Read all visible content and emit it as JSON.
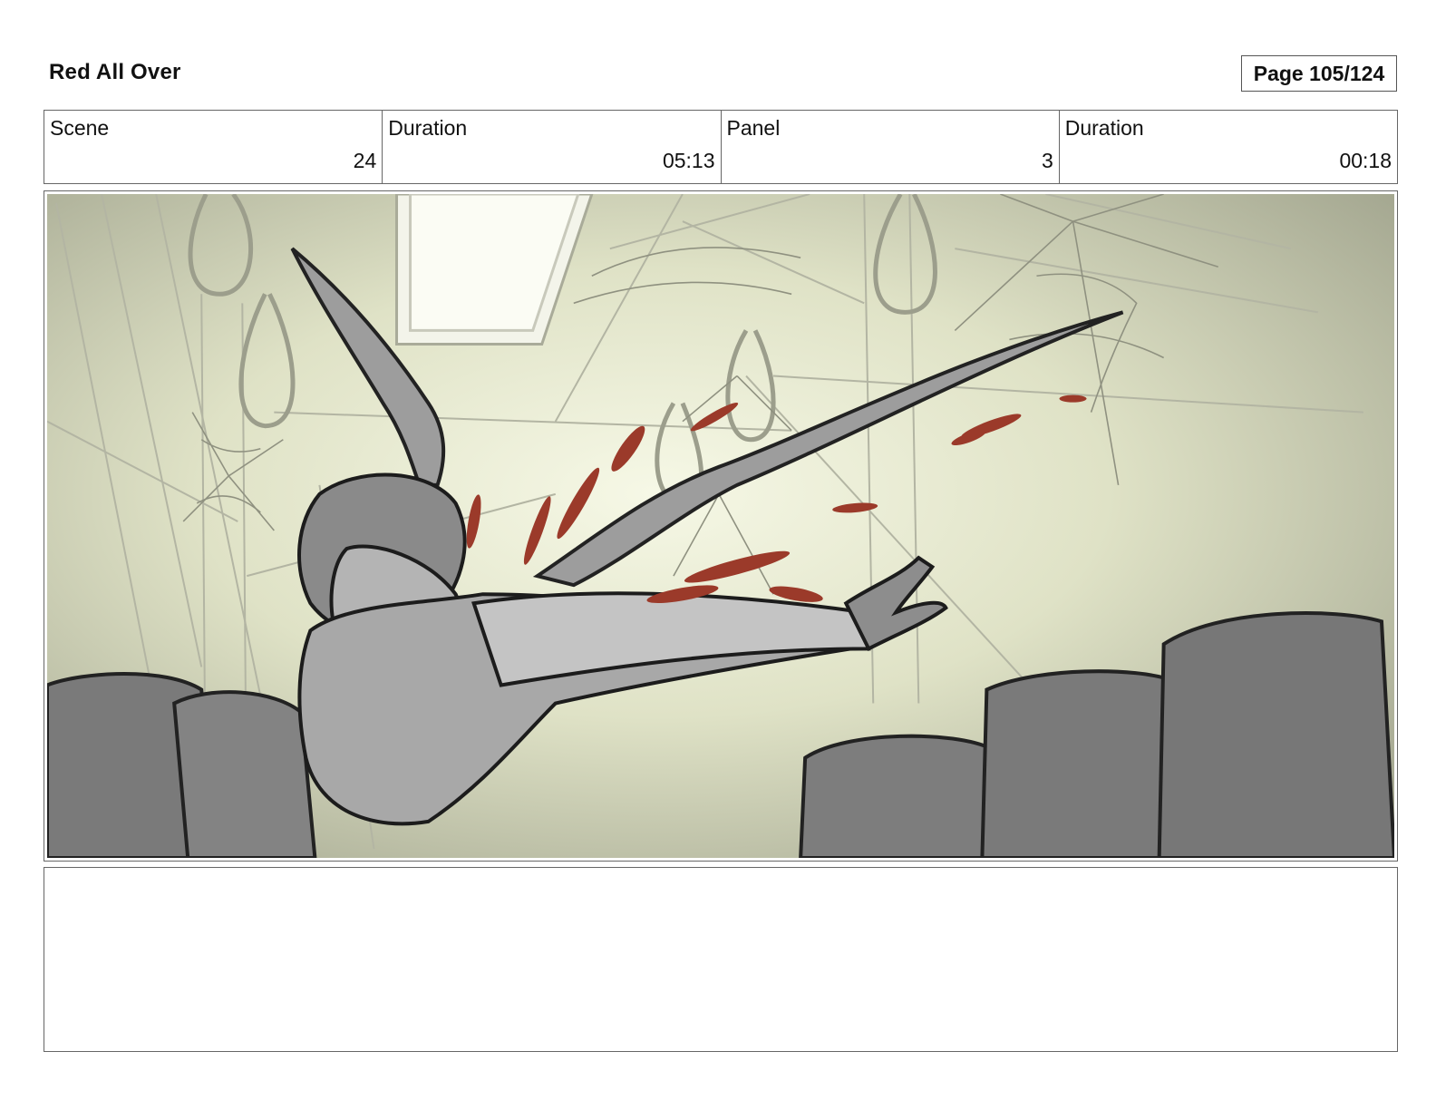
{
  "header": {
    "title": "Red All Over",
    "page": "Page 105/124"
  },
  "info": {
    "scene_label": "Scene",
    "scene_value": "24",
    "scene_duration_label": "Duration",
    "scene_duration_value": "05:13",
    "panel_label": "Panel",
    "panel_value": "3",
    "panel_duration_label": "Duration",
    "panel_duration_value": "00:18"
  },
  "colors": {
    "background_light": "#eef0d8",
    "background_dark": "#9da08a",
    "blood": "#9b3a2a",
    "seat": "#7b7b7b"
  }
}
